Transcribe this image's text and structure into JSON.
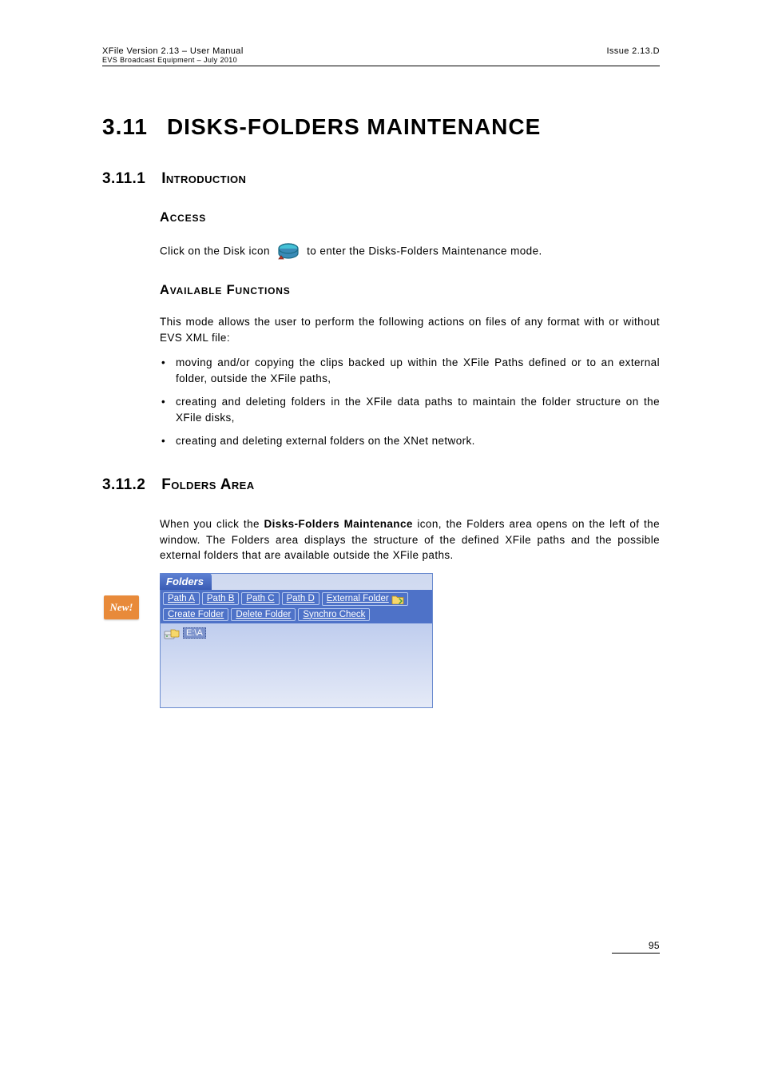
{
  "header": {
    "left_line1": "XFile Version 2.13 – User Manual",
    "left_line2": "EVS Broadcast Equipment – July 2010",
    "right": "Issue 2.13.D"
  },
  "section": {
    "number": "3.11",
    "title": "DISKS-FOLDERS MAINTENANCE"
  },
  "s1": {
    "number": "3.11.1",
    "title": "Introduction",
    "access_heading": "Access",
    "access_text_before": "Click on the Disk icon ",
    "access_text_after": " to enter the Disks-Folders Maintenance mode.",
    "avail_heading": "Available Functions",
    "avail_intro": "This mode allows the user to perform the following actions on files of any format with or without EVS XML file:",
    "bullets": [
      "moving and/or copying the clips backed up within the XFile Paths defined or to an external folder, outside the XFile paths,",
      "creating and deleting folders in the XFile data paths to maintain the folder structure on the XFile disks,",
      "creating and deleting external folders on the XNet network."
    ]
  },
  "s2": {
    "number": "3.11.2",
    "title": "Folders Area",
    "para": "When you click the Disks-Folders Maintenance icon, the Folders area opens on the left of the window. The Folders area displays the structure of the defined XFile paths and the possible external folders that are available outside the XFile paths.",
    "bold_phrase": "Disks-Folders Maintenance",
    "new_badge": "New!"
  },
  "folders_panel": {
    "tab": "Folders",
    "row1": [
      "Path A",
      "Path B",
      "Path C",
      "Path D",
      "External Folder"
    ],
    "row2": [
      "Create Folder",
      "Delete Folder",
      "Synchro Check"
    ],
    "tree_item": "E:\\A"
  },
  "footer": {
    "page": "95"
  }
}
